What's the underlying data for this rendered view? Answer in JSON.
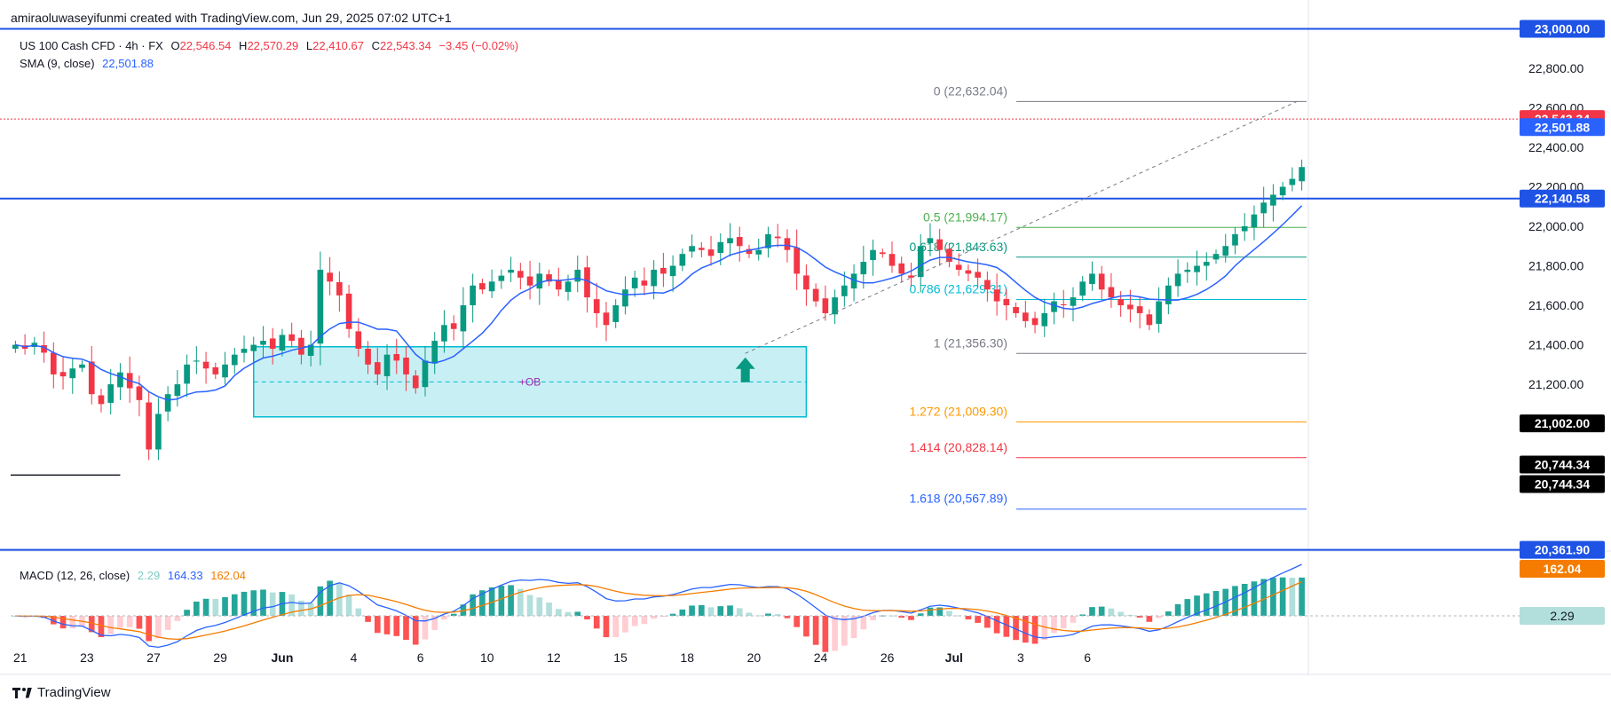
{
  "header": {
    "title": "amiraoluwaseyifunmi created with TradingView.com, Jun 29, 2025 07:02 UTC+1"
  },
  "legend": {
    "symbol": "US 100 Cash CFD · 4h · FX",
    "o_label": "O",
    "o_value": "22,546.54",
    "h_label": "H",
    "h_value": "22,570.29",
    "l_label": "L",
    "l_value": "22,410.67",
    "c_label": "C",
    "c_value": "22,543.34",
    "change": "−3.45 (−0.02%)",
    "sma_label": "SMA (9, close)",
    "sma_value": "22,501.88",
    "macd_label": "MACD (12, 26, close)",
    "macd_hist": "2.29",
    "macd_line": "164.33",
    "macd_signal": "162.04"
  },
  "footer": {
    "brand": "TradingView"
  },
  "colors": {
    "up": "#089981",
    "down": "#f23645",
    "sma": "#2962ff",
    "signal": "#f57c00",
    "hline": "#1e53e5",
    "ob_fill": "#c8f0f4",
    "ob_border": "#00bcd4",
    "ob_label": "#9c27b0"
  },
  "chart_data": [
    {
      "type": "candlestick",
      "interval": "4h",
      "ylim": [
        20360,
        23020
      ],
      "y_ticks": [
        21200,
        21400,
        21600,
        21800,
        22000,
        22200,
        22400,
        22600,
        22800
      ],
      "y_tick_labels": [
        "21,200.00",
        "21,400.00",
        "21,600.00",
        "21,800.00",
        "22,000.00",
        "22,200.00",
        "22,400.00",
        "22,600.00",
        "22,800.00"
      ],
      "x_ticks": [
        {
          "label": "21",
          "pos": 0.5
        },
        {
          "label": "23",
          "pos": 7.5
        },
        {
          "label": "27",
          "pos": 14.5
        },
        {
          "label": "29",
          "pos": 21.5
        },
        {
          "label": "Jun",
          "pos": 28.0
        },
        {
          "label": "4",
          "pos": 35.5
        },
        {
          "label": "6",
          "pos": 42.5
        },
        {
          "label": "10",
          "pos": 49.5
        },
        {
          "label": "12",
          "pos": 56.5
        },
        {
          "label": "15",
          "pos": 63.5
        },
        {
          "label": "18",
          "pos": 70.5
        },
        {
          "label": "20",
          "pos": 77.5
        },
        {
          "label": "24",
          "pos": 84.5
        },
        {
          "label": "26",
          "pos": 91.5
        },
        {
          "label": "Jul",
          "pos": 98.5
        },
        {
          "label": "3",
          "pos": 105.5
        },
        {
          "label": "6",
          "pos": 112.5
        }
      ],
      "x_range": [
        -0.5,
        135.5
      ],
      "closes": [
        21400,
        21380,
        21410,
        21360,
        21250,
        21240,
        21280,
        21300,
        21150,
        21100,
        21200,
        21260,
        21180,
        21120,
        20870,
        21050,
        21150,
        21200,
        21300,
        21320,
        21280,
        21250,
        21300,
        21350,
        21380,
        21400,
        21420,
        21380,
        21450,
        21420,
        21350,
        21400,
        21780,
        21720,
        21650,
        21480,
        21380,
        21300,
        21250,
        21350,
        21320,
        21250,
        21180,
        21320,
        21420,
        21500,
        21480,
        21600,
        21700,
        21680,
        21720,
        21750,
        21780,
        21740,
        21700,
        21760,
        21720,
        21680,
        21720,
        21780,
        21640,
        21560,
        21500,
        21600,
        21680,
        21740,
        21700,
        21780,
        21760,
        21800,
        21860,
        21900,
        21880,
        21850,
        21920,
        21940,
        21900,
        21860,
        21880,
        21960,
        21940,
        21880,
        21760,
        21680,
        21620,
        21560,
        21640,
        21700,
        21760,
        21820,
        21880,
        21860,
        21800,
        21760,
        21740,
        21900,
        21940,
        21880,
        21820,
        21780,
        21760,
        21740,
        21680,
        21620,
        21600,
        21560,
        21520,
        21500,
        21560,
        21620,
        21600,
        21640,
        21720,
        21760,
        21680,
        21640,
        21600,
        21580,
        21560,
        21500,
        21620,
        21700,
        21760,
        21780,
        21800,
        21820,
        21860,
        21900,
        21960,
        22000,
        22060,
        22120,
        22160,
        22200,
        22240,
        22300
      ],
      "ohlc_note": "4h candles; values read approximately from chart",
      "fib": [
        {
          "label": "0 (22,632.04)",
          "price": 22632.04,
          "color": "#787b86"
        },
        {
          "label": "0.5 (21,994.17)",
          "price": 21994.17,
          "color": "#4caf50"
        },
        {
          "label": "0.618 (21,843.63)",
          "price": 21843.63,
          "color": "#089981"
        },
        {
          "label": "0.786 (21,629.31)",
          "price": 21629.31,
          "color": "#00bcd4"
        },
        {
          "label": "1 (21,356.30)",
          "price": 21356.3,
          "color": "#787b86"
        },
        {
          "label": "1.272 (21,009.30)",
          "price": 21009.3,
          "color": "#ff9800"
        },
        {
          "label": "1.414 (20,828.14)",
          "price": 20828.14,
          "color": "#f23645"
        },
        {
          "label": "1.618 (20,567.89)",
          "price": 20567.89,
          "color": "#2962ff"
        }
      ],
      "levels": [
        {
          "label": "23,000.00",
          "price": 23000.0
        },
        {
          "label": "22,140.58",
          "price": 22140.58
        },
        {
          "label": "20,361.90",
          "price": 20361.9
        }
      ],
      "price_tags": [
        {
          "label": "22,543.34",
          "price": 22543.34,
          "bg": "#f23645"
        },
        {
          "label": "22,501.88",
          "price": 22501.88,
          "bg": "#2962ff"
        },
        {
          "label": "21,002.00",
          "price": 21002.0,
          "bg": "#000000"
        },
        {
          "label": "20,744.34",
          "price": 20744.34,
          "bg": "#000000",
          "offset": -1
        },
        {
          "label": "20,744.34",
          "price": 20744.34,
          "bg": "#000000",
          "offset": 1
        }
      ],
      "order_block": {
        "label": "+OB",
        "top": 21390,
        "bottom": 21035,
        "mid": 21212,
        "x_start": 25,
        "x_end": 83
      },
      "left_support": {
        "price": 20740,
        "x_start": -0.5,
        "x_end": 11
      },
      "current_price": 22543.34,
      "arrow_up": {
        "x": 76.6,
        "price": 21336
      }
    },
    {
      "type": "macd",
      "histogram_last": 2.29,
      "macd_last": 164.33,
      "signal_last": 162.04,
      "tags": [
        {
          "label": "162.04",
          "bg": "#f57c00"
        },
        {
          "label": "2.29",
          "bg": "#b2dfdb"
        }
      ]
    }
  ]
}
